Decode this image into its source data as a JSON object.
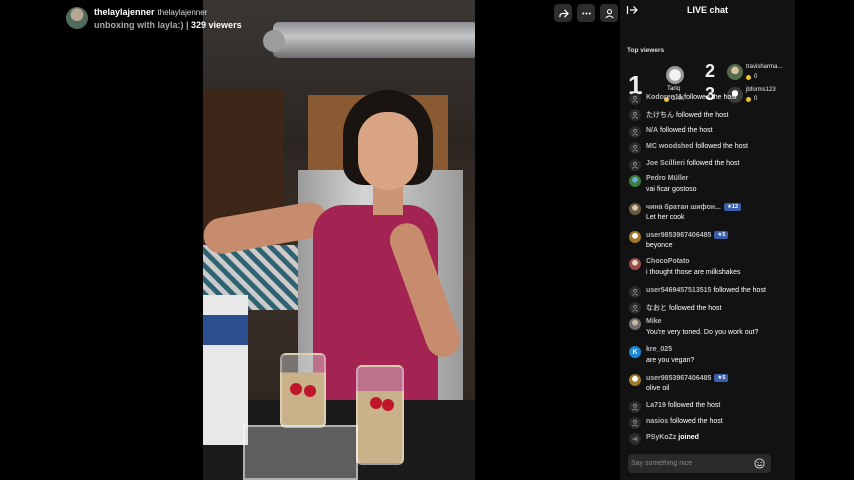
{
  "host": {
    "name": "thelaylajenner",
    "handle": "thelaylajenner",
    "title": "unboxing with layla:)",
    "separator": " | ",
    "viewers": "329 viewers"
  },
  "actions": [
    "share-icon",
    "more-icon",
    "profile-icon"
  ],
  "chat": {
    "title": "LIVE chat",
    "top_viewers_label": "Top viewers",
    "top_viewers": [
      {
        "rank": "1",
        "name": "Tariq",
        "score": "2.4K"
      },
      {
        "rank": "2",
        "name": "travisharma...",
        "score": "0"
      },
      {
        "rank": "3",
        "name": "jbforms123",
        "score": "0"
      }
    ],
    "messages": [
      {
        "user": "Kodoren11",
        "text": "followed the host"
      },
      {
        "user": "たけちん",
        "text": "followed the host"
      },
      {
        "user": "N/A",
        "text": "followed the host"
      },
      {
        "user": "MC woodshed",
        "text": "followed the host"
      },
      {
        "user": "Joe Scillieri",
        "text": "followed the host"
      },
      {
        "user": "Pedro Müller",
        "text": "vai ficar gostoso"
      },
      {
        "user": "чина братан шифон...",
        "badge": "13",
        "text": "Let her cook"
      },
      {
        "user": "user9853967406485",
        "badge": "5",
        "text": "beyonce"
      },
      {
        "user": "ChocoPotato",
        "text": "i thought those are milkshakes"
      },
      {
        "user": "user5469457513515",
        "text": "followed the host"
      },
      {
        "user": "なおと",
        "text": "followed the host"
      },
      {
        "user": "Mike",
        "text": "You're very toned. Do you work out?"
      },
      {
        "user": "kre_025",
        "avatar_letter": "K",
        "text": "are you vegan?"
      },
      {
        "user": "user9853967406485",
        "badge": "5",
        "text": "olive oil"
      },
      {
        "user": "La719",
        "text": "followed the host"
      },
      {
        "user": "nasios",
        "text": "followed the host"
      },
      {
        "user": "PSyKoZz",
        "text": "joined"
      }
    ],
    "input_placeholder": "Say something nice"
  },
  "colors": {
    "chat_bg": "#121212",
    "badge": "#3a5ea8",
    "coin": "#f2c230",
    "video_dress": "#a32353"
  }
}
